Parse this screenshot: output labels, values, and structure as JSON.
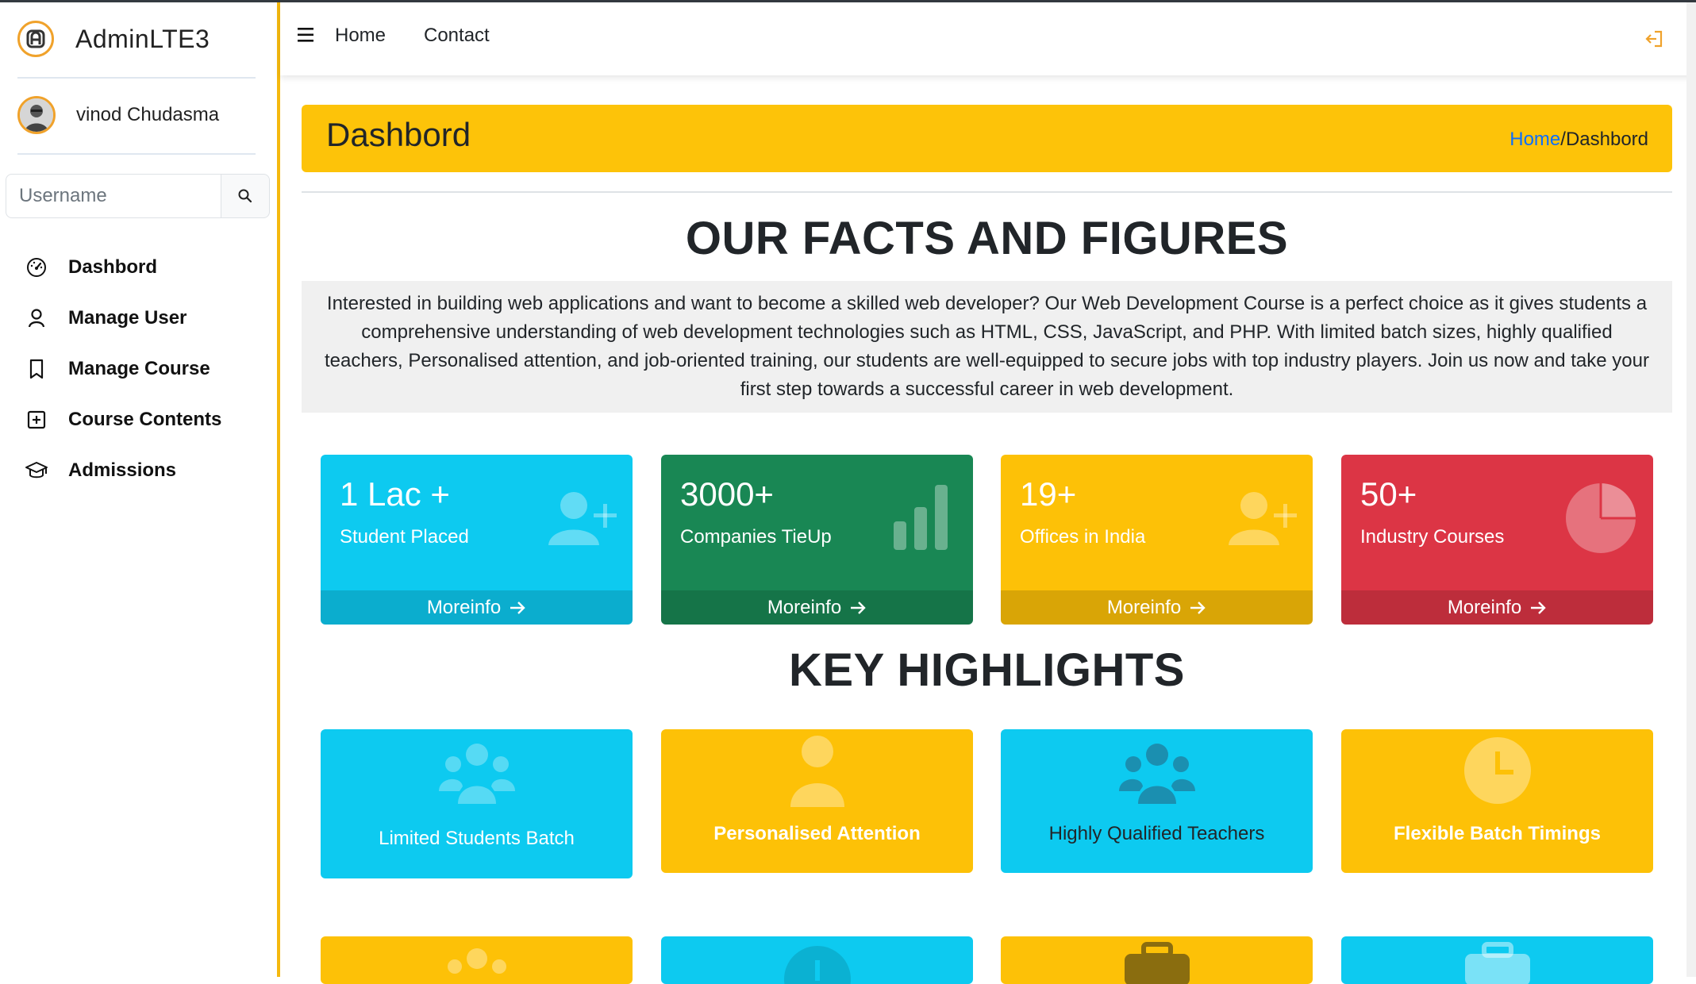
{
  "brand": {
    "name": "AdminLTE3"
  },
  "user": {
    "name": "vinod Chudasma"
  },
  "search": {
    "placeholder": "Username"
  },
  "sidebar": {
    "items": [
      {
        "label": "Dashbord",
        "icon": "speedometer-icon"
      },
      {
        "label": "Manage User",
        "icon": "person-icon"
      },
      {
        "label": "Manage Course",
        "icon": "bookmark-icon"
      },
      {
        "label": "Course Contents",
        "icon": "plus-square-icon"
      },
      {
        "label": "Admissions",
        "icon": "mortarboard-icon"
      }
    ]
  },
  "navbar": {
    "links": [
      "Home",
      "Contact"
    ]
  },
  "page": {
    "title": "Dashbord",
    "breadcrumb": {
      "home": "Home",
      "separator": "/",
      "current": "Dashbord"
    }
  },
  "facts": {
    "heading": "OUR FACTS AND FIGURES",
    "intro": "Interested in building web applications and want to become a skilled web developer? Our Web Development Course is a perfect choice as it gives students a comprehensive understanding of web development technologies such as HTML, CSS, JavaScript, and PHP. With limited batch sizes, highly qualified teachers, Personalised attention, and job-oriented training, our students are well-equipped to secure jobs with top industry players. Join us now and take your first step towards a successful career in web development.",
    "cards": [
      {
        "number": "1 Lac +",
        "label": "Student Placed",
        "link": "Moreinfo",
        "color": "#0dcaf0",
        "icon": "person-plus-icon"
      },
      {
        "number": "3000+",
        "label": "Companies TieUp",
        "link": "Moreinfo",
        "color": "#198754",
        "icon": "bar-chart-icon"
      },
      {
        "number": "19+",
        "label": "Offices in India",
        "link": "Moreinfo",
        "color": "#fdc107",
        "icon": "person-plus-icon"
      },
      {
        "number": "50+",
        "label": "Industry Courses",
        "link": "Moreinfo",
        "color": "#dc3545",
        "icon": "pie-chart-icon"
      }
    ]
  },
  "highlights": {
    "heading": "KEY HIGHLIGHTS",
    "items": [
      {
        "label": "Limited Students Batch",
        "color": "#0dcaf0",
        "icon": "people-icon"
      },
      {
        "label": "Personalised Attention",
        "color": "#fdc107",
        "icon": "person-icon"
      },
      {
        "label": "Highly Qualified Teachers",
        "color": "#0dcaf0",
        "icon": "people-icon"
      },
      {
        "label": "Flexible Batch Timings",
        "color": "#fdc107",
        "icon": "clock-icon"
      }
    ]
  },
  "colors": {
    "accent": "#fdc309",
    "sidebar_border": "#f5b90f",
    "link": "#0d6efd"
  }
}
